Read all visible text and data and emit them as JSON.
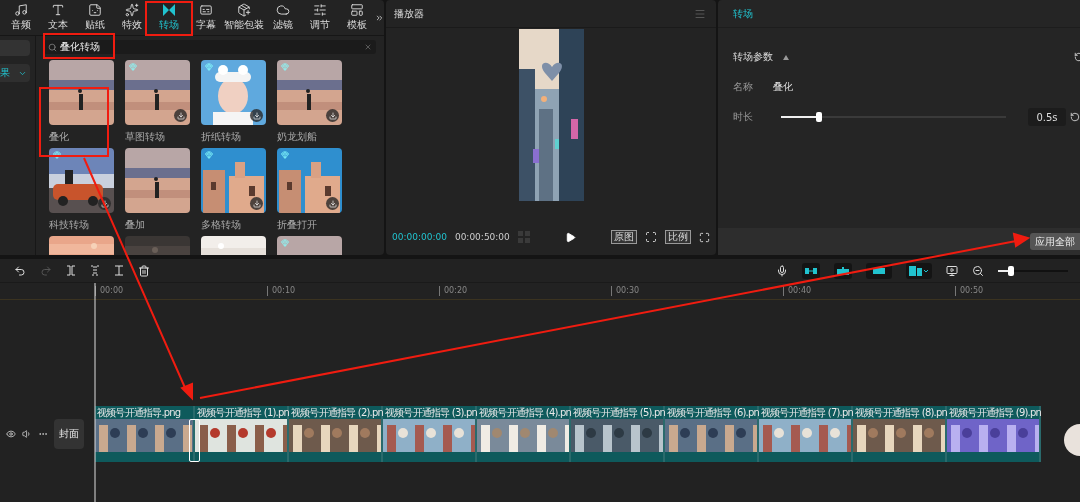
{
  "nav_tabs": [
    {
      "label": "音频",
      "selected": false
    },
    {
      "label": "文本",
      "selected": false
    },
    {
      "label": "贴纸",
      "selected": false
    },
    {
      "label": "特效",
      "selected": false
    },
    {
      "label": "转场",
      "selected": true
    },
    {
      "label": "字幕",
      "selected": false
    },
    {
      "label": "智能包装",
      "selected": false
    },
    {
      "label": "滤镜",
      "selected": false
    },
    {
      "label": "调节",
      "selected": false
    },
    {
      "label": "模板",
      "selected": false
    }
  ],
  "sidebar": {
    "items": [
      {
        "label": "果",
        "selected": true
      }
    ]
  },
  "search": {
    "value": "叠化转场"
  },
  "effects": [
    {
      "label": "叠化",
      "premium": false,
      "download": false
    },
    {
      "label": "草图转场",
      "premium": true,
      "download": true
    },
    {
      "label": "折纸转场",
      "premium": true,
      "download": true
    },
    {
      "label": "奶龙划船",
      "premium": true,
      "download": true
    },
    {
      "label": "科技转场",
      "premium": true,
      "download": true
    },
    {
      "label": "叠加",
      "premium": false,
      "download": false
    },
    {
      "label": "多格转场",
      "premium": true,
      "download": true
    },
    {
      "label": "折叠打开",
      "premium": true,
      "download": true
    },
    {
      "premium": false,
      "download": false
    },
    {
      "premium": false,
      "download": false
    },
    {
      "premium": false,
      "download": false
    },
    {
      "premium": true,
      "download": false
    }
  ],
  "player": {
    "title": "播放器",
    "current_time": "00:00:00:00",
    "total_time": "00:00:50:00",
    "buttons": [
      "原图",
      "比例"
    ]
  },
  "inspector": {
    "title": "转场",
    "section": "转场参数",
    "section_expanded": true,
    "name_label": "名称",
    "name_value": "叠化",
    "duration_label": "时长",
    "duration": {
      "level": 0.17
    },
    "duration_value": "0.5s",
    "apply_button": "应用全部"
  },
  "timeline": {
    "redo_disabled": true,
    "toggles": [
      {
        "on": true
      },
      {
        "on": true
      },
      {
        "on": true
      },
      {
        "on": true
      }
    ],
    "zoom": {
      "level": 0.18
    },
    "ruler": [
      "00:00",
      "00:10",
      "00:20",
      "00:30",
      "00:40",
      "00:50"
    ],
    "cover": "封面",
    "clips": [
      {
        "name": "视频号开通指导.png"
      },
      {
        "name": "视频号开通指导 (1).pn"
      },
      {
        "name": "视频号开通指导 (2).pn"
      },
      {
        "name": "视频号开通指导 (3).pn"
      },
      {
        "name": "视频号开通指导 (4).pn"
      },
      {
        "name": "视频号开通指导 (5).pn"
      },
      {
        "name": "视频号开通指导 (6).pn"
      },
      {
        "name": "视频号开通指导 (7).pn"
      },
      {
        "name": "视频号开通指导 (8).pn"
      },
      {
        "name": "视频号开通指导 (9).pn"
      }
    ]
  }
}
